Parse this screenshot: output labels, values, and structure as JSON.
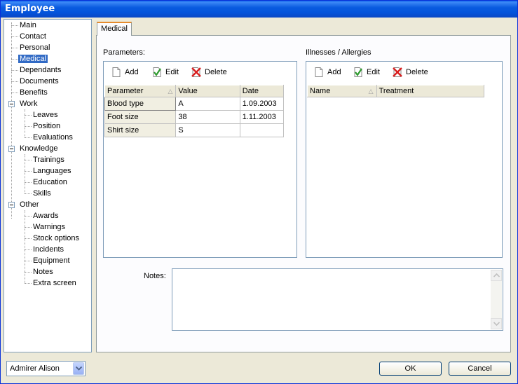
{
  "window": {
    "title": "Employee"
  },
  "tree": {
    "items": [
      {
        "label": "Main"
      },
      {
        "label": "Contact"
      },
      {
        "label": "Personal"
      },
      {
        "label": "Medical",
        "selected": true
      },
      {
        "label": "Dependants"
      },
      {
        "label": "Documents"
      },
      {
        "label": "Benefits"
      },
      {
        "label": "Work",
        "expanded": true
      },
      {
        "label": "Leaves"
      },
      {
        "label": "Position"
      },
      {
        "label": "Evaluations"
      },
      {
        "label": "Knowledge",
        "expanded": true
      },
      {
        "label": "Trainings"
      },
      {
        "label": "Languages"
      },
      {
        "label": "Education"
      },
      {
        "label": "Skills"
      },
      {
        "label": "Other",
        "expanded": true
      },
      {
        "label": "Awards"
      },
      {
        "label": "Warnings"
      },
      {
        "label": "Stock options"
      },
      {
        "label": "Incidents"
      },
      {
        "label": "Equipment"
      },
      {
        "label": "Notes"
      },
      {
        "label": "Extra screen"
      }
    ]
  },
  "user_combo": {
    "value": "Admirer Alison"
  },
  "tab": {
    "label": "Medical"
  },
  "parameters": {
    "title": "Parameters:",
    "toolbar": {
      "add": "Add",
      "edit": "Edit",
      "delete": "Delete"
    },
    "columns": [
      "Parameter",
      "Value",
      "Date"
    ],
    "rows": [
      [
        "Blood type",
        "A",
        "1.09.2003"
      ],
      [
        "Foot size",
        "38",
        "1.11.2003"
      ],
      [
        "Shirt size",
        "S",
        ""
      ]
    ]
  },
  "illnesses": {
    "title": "Illnesses / Allergies",
    "toolbar": {
      "add": "Add",
      "edit": "Edit",
      "delete": "Delete"
    },
    "columns": [
      "Name",
      "Treatment"
    ]
  },
  "notes": {
    "label": "Notes:"
  },
  "buttons": {
    "ok": "OK",
    "cancel": "Cancel"
  },
  "colors": {
    "selection": "#316ac5",
    "title_bar": "#0a5bdf",
    "tab_accent": "#e68b2c"
  },
  "icons": {
    "add": "page-icon",
    "edit": "check-icon",
    "delete": "red-x-icon"
  }
}
